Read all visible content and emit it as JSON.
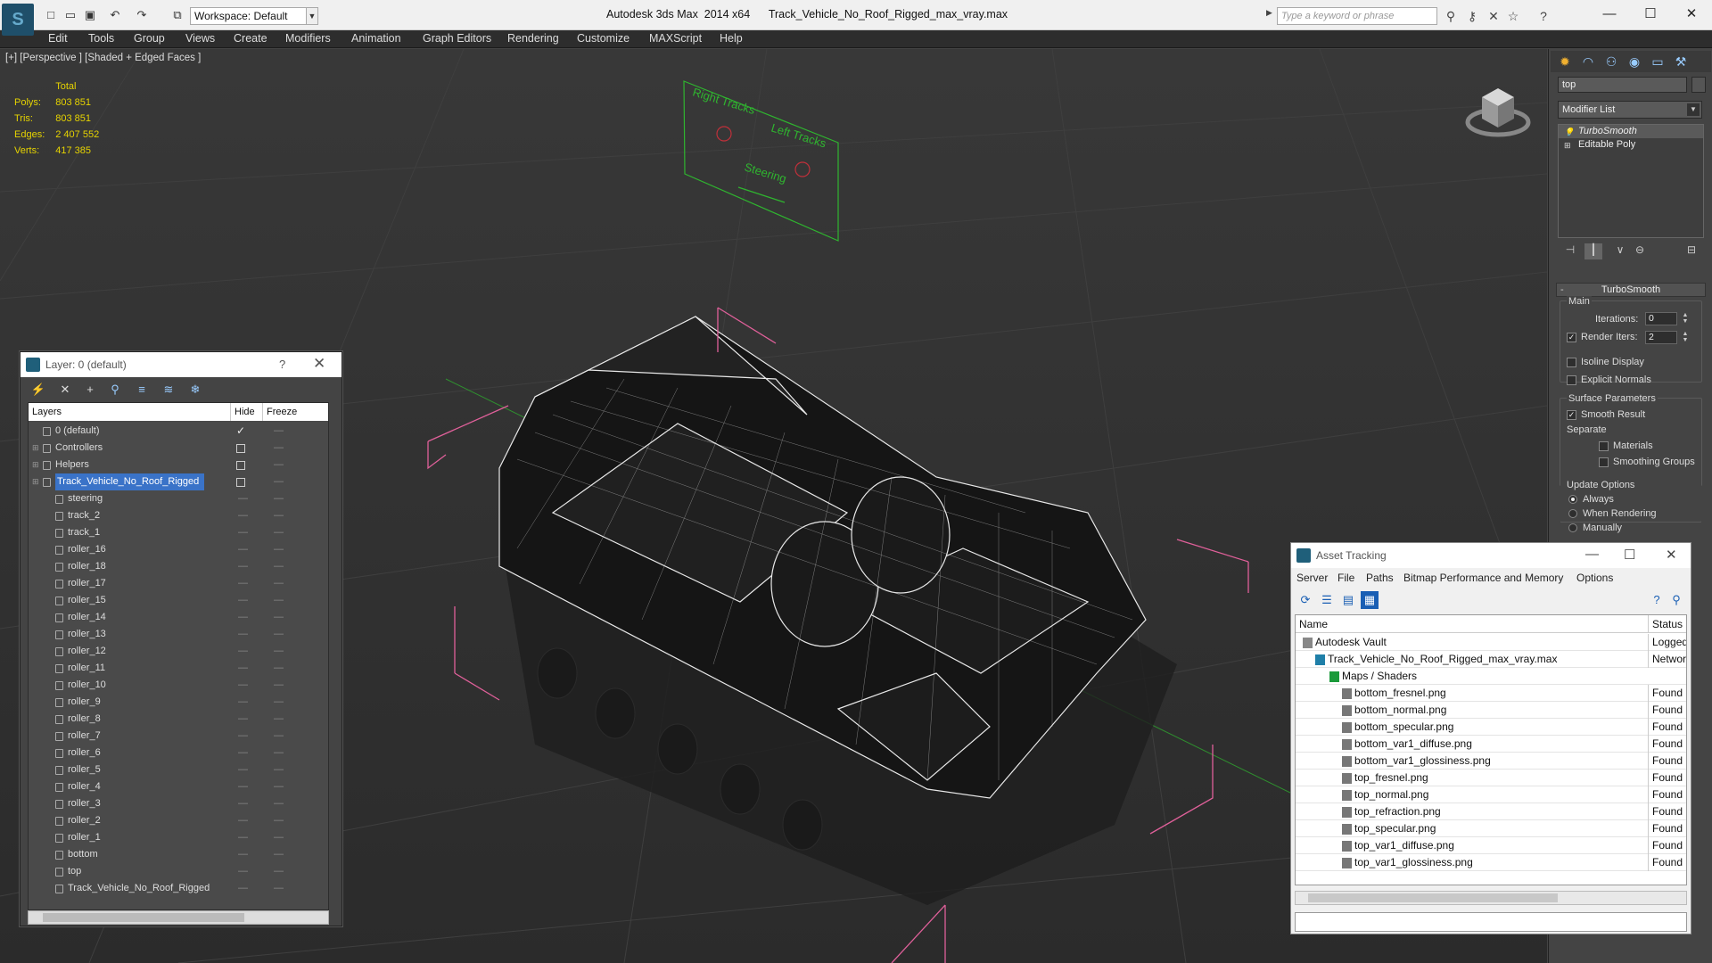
{
  "titlebar": {
    "app_title": "Autodesk 3ds Max  2014 x64",
    "file_title": "Track_Vehicle_No_Roof_Rigged_max_vray.max",
    "workspace": "Workspace: Default",
    "search_placeholder": "Type a keyword or phrase"
  },
  "menubar": [
    "Edit",
    "Tools",
    "Group",
    "Views",
    "Create",
    "Modifiers",
    "Animation",
    "Graph Editors",
    "Rendering",
    "Customize",
    "MAXScript",
    "Help"
  ],
  "viewport": {
    "label": "[+] [Perspective ] [Shaded + Edged Faces ]",
    "stats": {
      "header": "Total",
      "rows": [
        {
          "k": "Polys:",
          "v": "803 851"
        },
        {
          "k": "Tris:",
          "v": "803 851"
        },
        {
          "k": "Edges:",
          "v": "2 407 552"
        },
        {
          "k": "Verts:",
          "v": "417 385"
        }
      ]
    },
    "rig_labels": {
      "right": "Right Tracks",
      "left": "Left Tracks",
      "steering": "Steering"
    }
  },
  "command_panel": {
    "object_name": "top",
    "modifier_list": "Modifier List",
    "stack": [
      "TurboSmooth",
      "Editable Poly"
    ],
    "rollout_title": "TurboSmooth",
    "main_label": "Main",
    "iterations_label": "Iterations:",
    "iterations": "0",
    "render_iters_label": "Render Iters:",
    "render_iters": "2",
    "isoline": "Isoline Display",
    "explicit_normals": "Explicit Normals",
    "surface_params": "Surface Parameters",
    "smooth_result": "Smooth Result",
    "separate": "Separate",
    "materials": "Materials",
    "smoothing_groups": "Smoothing Groups",
    "update_options": "Update Options",
    "always": "Always",
    "when_rendering": "When Rendering",
    "manually": "Manually"
  },
  "layer_window": {
    "title": "Layer: 0 (default)",
    "col_layers": "Layers",
    "col_hide": "Hide",
    "col_freeze": "Freeze",
    "layers": [
      {
        "name": "0 (default)"
      },
      {
        "name": "Controllers"
      },
      {
        "name": "Helpers"
      },
      {
        "name": "Track_Vehicle_No_Roof_Rigged"
      }
    ],
    "objects": [
      "steering",
      "track_2",
      "track_1",
      "roller_16",
      "roller_18",
      "roller_17",
      "roller_15",
      "roller_14",
      "roller_13",
      "roller_12",
      "roller_11",
      "roller_10",
      "roller_9",
      "roller_8",
      "roller_7",
      "roller_6",
      "roller_5",
      "roller_4",
      "roller_3",
      "roller_2",
      "roller_1",
      "bottom",
      "top",
      "Track_Vehicle_No_Roof_Rigged"
    ]
  },
  "asset_tracking": {
    "title": "Asset Tracking",
    "menu": [
      "Server",
      "File",
      "Paths",
      "Bitmap Performance and Memory",
      "Options"
    ],
    "col_name": "Name",
    "col_status": "Status",
    "rows": [
      {
        "name": "Autodesk Vault",
        "status": "Logged O"
      },
      {
        "name": "Track_Vehicle_No_Roof_Rigged_max_vray.max",
        "status": "Network"
      },
      {
        "name": "Maps / Shaders",
        "status": ""
      },
      {
        "name": "bottom_fresnel.png",
        "status": "Found"
      },
      {
        "name": "bottom_normal.png",
        "status": "Found"
      },
      {
        "name": "bottom_specular.png",
        "status": "Found"
      },
      {
        "name": "bottom_var1_diffuse.png",
        "status": "Found"
      },
      {
        "name": "bottom_var1_glossiness.png",
        "status": "Found"
      },
      {
        "name": "top_fresnel.png",
        "status": "Found"
      },
      {
        "name": "top_normal.png",
        "status": "Found"
      },
      {
        "name": "top_refraction.png",
        "status": "Found"
      },
      {
        "name": "top_specular.png",
        "status": "Found"
      },
      {
        "name": "top_var1_diffuse.png",
        "status": "Found"
      },
      {
        "name": "top_var1_glossiness.png",
        "status": "Found"
      }
    ]
  },
  "colors": {
    "stats": "#e6d300",
    "selection": "#3a73c8",
    "rig_green": "#2fb52f",
    "bbox_pink": "#e0609a"
  }
}
